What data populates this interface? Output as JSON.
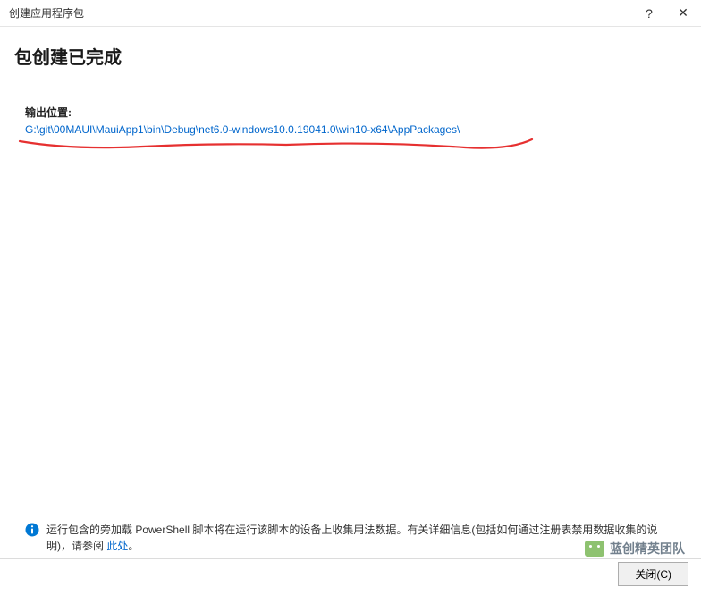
{
  "titlebar": {
    "title": "创建应用程序包",
    "help": "?",
    "close": "✕"
  },
  "heading": "包创建已完成",
  "output": {
    "label": "输出位置:",
    "path": "G:\\git\\00MAUI\\MauiApp1\\bin\\Debug\\net6.0-windows10.0.19041.0\\win10-x64\\AppPackages\\"
  },
  "footer": {
    "info_text_1": "运行包含的旁加载 PowerShell 脚本将在运行该脚本的设备上收集用法数据。有关详细信息(包括如何通过注册表禁用数据收集的说明)，请参阅 ",
    "info_link": "此处",
    "info_text_2": "。"
  },
  "buttons": {
    "close": "关闭(C)"
  },
  "watermark": {
    "text": "蓝创精英团队"
  }
}
